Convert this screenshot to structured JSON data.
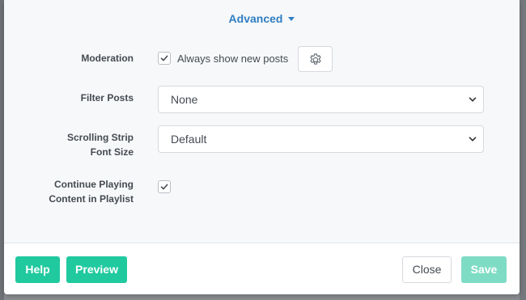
{
  "advanced": {
    "label": "Advanced",
    "icon": "caret-down-icon"
  },
  "moderation": {
    "label": "Moderation",
    "checkbox_checked": true,
    "checkbox_label": "Always show new posts",
    "settings_icon": "gear-icon"
  },
  "filter_posts": {
    "label": "Filter Posts",
    "selected": "None"
  },
  "font_size": {
    "label_line1": "Scrolling Strip",
    "label_line2": "Font Size",
    "selected": "Default"
  },
  "continue_playing": {
    "label_line1": "Continue Playing",
    "label_line2": "Content in Playlist",
    "checkbox_checked": true
  },
  "footer": {
    "help_label": "Help",
    "preview_label": "Preview",
    "close_label": "Close",
    "save_label": "Save"
  },
  "colors": {
    "accent_blue": "#2f7ec2",
    "teal": "#21c99f",
    "teal_disabled": "#7fdcc4"
  }
}
